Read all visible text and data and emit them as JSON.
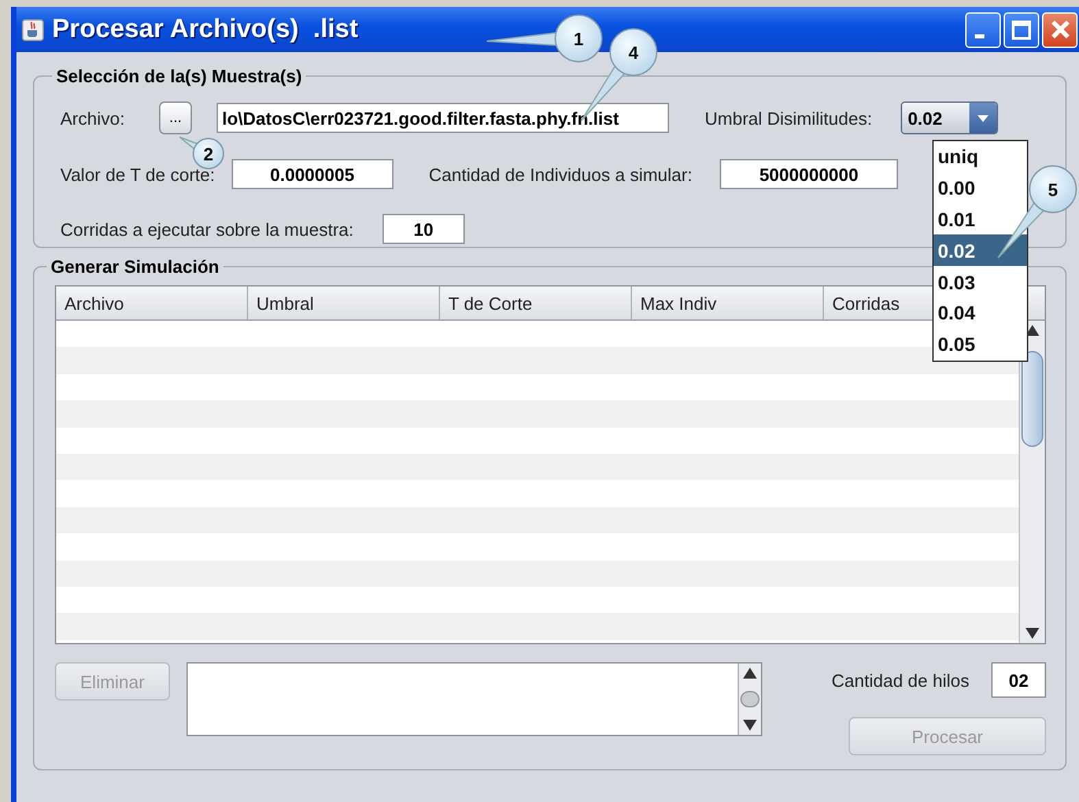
{
  "window": {
    "title": "Procesar Archivo(s)  .list"
  },
  "annotations": [
    {
      "label": "1"
    },
    {
      "label": "2"
    },
    {
      "label": "4"
    },
    {
      "label": "5"
    }
  ],
  "sample_section": {
    "legend": "Selección de la(s) Muestra(s)",
    "file_label": "Archivo:",
    "browse_button": "...",
    "file_path": "lo\\DatosC\\err023721.good.filter.fasta.phy.fn.list",
    "threshold_label": "Umbral Disimilitudes:",
    "threshold_value": "0.02",
    "threshold_options": [
      {
        "label": "uniq",
        "selected": false
      },
      {
        "label": "0.00",
        "selected": false
      },
      {
        "label": "0.01",
        "selected": false
      },
      {
        "label": "0.02",
        "selected": true
      },
      {
        "label": "0.03",
        "selected": false
      },
      {
        "label": "0.04",
        "selected": false
      },
      {
        "label": "0.05",
        "selected": false
      }
    ],
    "cutoff_label": "Valor de T de corte:",
    "cutoff_value": "0.0000005",
    "individuals_label": "Cantidad de Individuos a simular:",
    "individuals_value": "5000000000",
    "runs_label": "Corridas a ejecutar sobre la muestra:",
    "runs_value": "10"
  },
  "simulation_section": {
    "legend": "Generar Simulación",
    "table": {
      "columns": [
        "Archivo",
        "Umbral",
        "T de Corte",
        "Max Indiv",
        "Corridas"
      ]
    },
    "delete_button": {
      "label": "Eliminar",
      "disabled": true
    },
    "threads_label": "Cantidad de hilos",
    "threads_value": "02",
    "process_button": {
      "label": "Procesar",
      "disabled": true
    }
  }
}
